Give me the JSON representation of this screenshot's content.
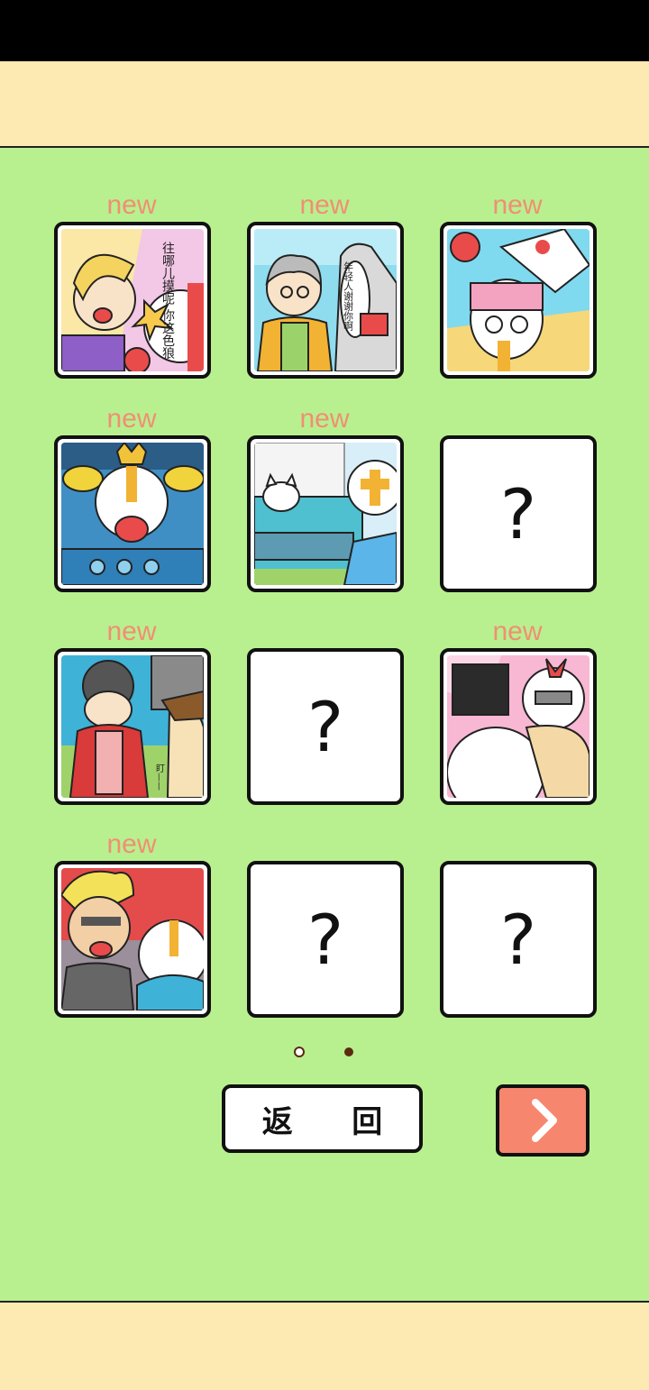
{
  "colors": {
    "background": "#b9f08f",
    "band": "#fdeab3",
    "new_tag": "#f08f74",
    "next_button": "#f7866f",
    "page_dot_active": "#5a2b0e"
  },
  "gallery": {
    "cells": [
      {
        "state": "unlocked",
        "tag": "new",
        "scene": "lady-punch",
        "speech": "往哪儿摸呢 你这色狼"
      },
      {
        "state": "unlocked",
        "tag": "new",
        "scene": "grandma-thanks",
        "speech": "年轻人谢谢你啊"
      },
      {
        "state": "unlocked",
        "tag": "new",
        "scene": "hero-knocked-down"
      },
      {
        "state": "unlocked",
        "tag": "new",
        "scene": "police-arrest"
      },
      {
        "state": "unlocked",
        "tag": "new",
        "scene": "cat-on-car"
      },
      {
        "state": "locked",
        "symbol": "?"
      },
      {
        "state": "unlocked",
        "tag": "new",
        "scene": "kimono-lady",
        "speech": "盯——"
      },
      {
        "state": "locked",
        "symbol": "?"
      },
      {
        "state": "unlocked",
        "tag": "new",
        "scene": "hero-hug"
      },
      {
        "state": "unlocked",
        "tag": "new",
        "scene": "angry-blond-man"
      },
      {
        "state": "locked",
        "symbol": "?"
      },
      {
        "state": "locked",
        "symbol": "?"
      }
    ]
  },
  "pagination": {
    "total": 2,
    "current": 2
  },
  "footer": {
    "back_label": "返 回",
    "next_icon": "chevron-right-icon"
  }
}
